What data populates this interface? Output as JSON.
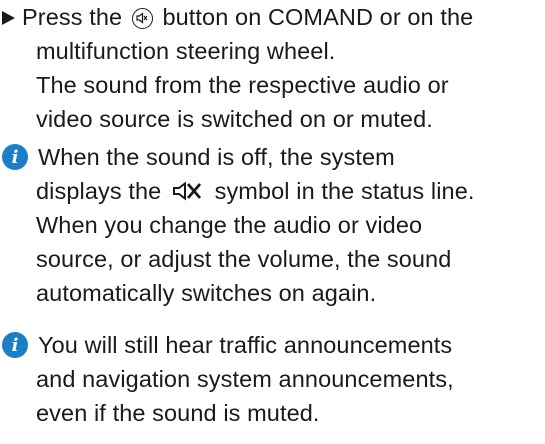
{
  "step": {
    "lines": [
      "Press the",
      "button on COMAND or on the",
      "multifunction steering wheel.",
      "The sound from the respective audio or",
      "video source is switched on or muted."
    ],
    "inline_icon": "mute-button-icon"
  },
  "note1": {
    "icon": "info-icon",
    "icon_glyph": "i",
    "lines": [
      "When the sound is off, the system",
      "displays the",
      "symbol in the status line.",
      "When you change the audio or video",
      "source, or adjust the volume, the sound",
      "automatically switches on again."
    ],
    "inline_icon": "mute-status-symbol-icon"
  },
  "note2": {
    "icon": "info-icon",
    "icon_glyph": "i",
    "lines": [
      "You will still hear traffic announcements",
      "and navigation system announcements,",
      "even if the sound is muted."
    ]
  },
  "colors": {
    "info_icon": "#1a7fc4",
    "text": "#1a1a1a"
  }
}
